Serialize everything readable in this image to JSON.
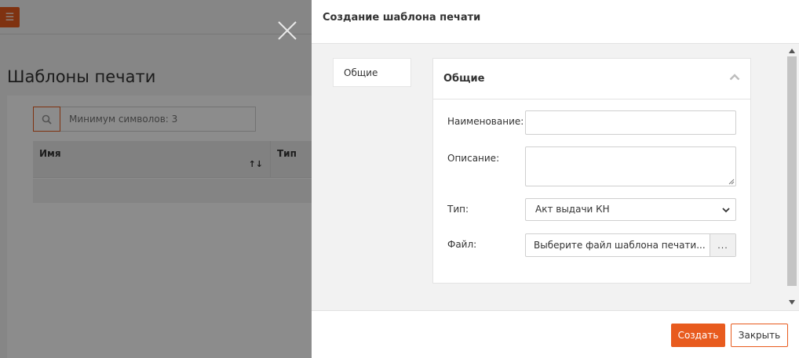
{
  "background": {
    "menu_icon": "hamburger-icon",
    "page_title": "Шаблоны печати",
    "search": {
      "placeholder": "Минимум символов: 3",
      "icon": "search-icon"
    },
    "grid": {
      "columns": [
        "Имя",
        "Тип"
      ],
      "sort_icon": "sort-asc-icon"
    }
  },
  "dialog": {
    "title": "Создание шаблона печати",
    "side_tabs": [
      {
        "label": "Общие"
      }
    ],
    "section": {
      "title": "Общие",
      "collapse_icon": "chevron-up-icon",
      "fields": {
        "name_label": "Наименование:",
        "name_value": "",
        "description_label": "Описание:",
        "description_value": "",
        "type_label": "Тип:",
        "type_value": "Акт выдачи КН",
        "file_label": "Файл:",
        "file_placeholder": "Выберите файл шаблона печати...",
        "file_browse": "..."
      }
    },
    "buttons": {
      "create": "Создать",
      "close": "Закрыть"
    }
  },
  "colors": {
    "accent": "#e85b1e",
    "body_bg": "#f2f2f2",
    "overlay": "rgba(0,0,0,0.45)"
  }
}
